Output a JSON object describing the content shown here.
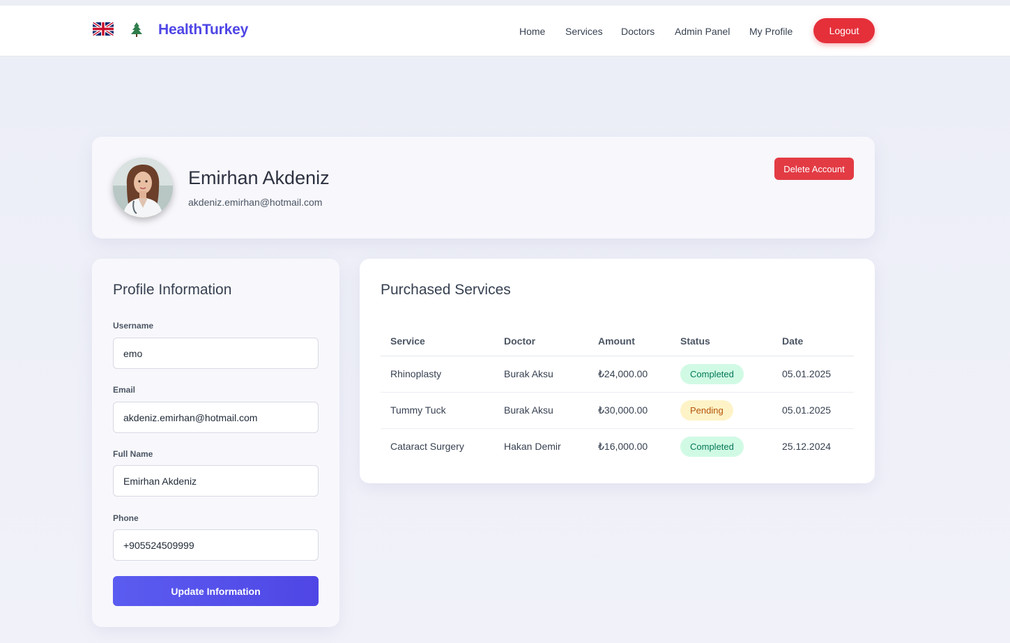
{
  "navbar": {
    "brand": "HealthTurkey",
    "links": [
      "Home",
      "Services",
      "Doctors",
      "Admin Panel",
      "My Profile"
    ],
    "logout_label": "Logout",
    "language_flag": "uk-flag-icon",
    "logo_icon": "tree-icon",
    "accent_color": "#4f46e5",
    "logout_color": "#e5303a"
  },
  "profile_header": {
    "name": "Emirhan Akdeniz",
    "email": "akdeniz.emirhan@hotmail.com",
    "delete_label": "Delete Account"
  },
  "profile_form": {
    "title": "Profile Information",
    "fields": [
      {
        "label": "Username",
        "value": "emo"
      },
      {
        "label": "Email",
        "value": "akdeniz.emirhan@hotmail.com"
      },
      {
        "label": "Full Name",
        "value": "Emirhan Akdeniz"
      },
      {
        "label": "Phone",
        "value": "+905524509999"
      }
    ],
    "submit_label": "Update Information"
  },
  "services": {
    "title": "Purchased Services",
    "columns": [
      "Service",
      "Doctor",
      "Amount",
      "Status",
      "Date"
    ],
    "rows": [
      {
        "service": "Rhinoplasty",
        "doctor": "Burak Aksu",
        "amount": "₺24,000.00",
        "status": "Completed",
        "date": "05.01.2025"
      },
      {
        "service": "Tummy Tuck",
        "doctor": "Burak Aksu",
        "amount": "₺30,000.00",
        "status": "Pending",
        "date": "05.01.2025"
      },
      {
        "service": "Cataract Surgery",
        "doctor": "Hakan Demir",
        "amount": "₺16,000.00",
        "status": "Completed",
        "date": "25.12.2024"
      }
    ]
  }
}
